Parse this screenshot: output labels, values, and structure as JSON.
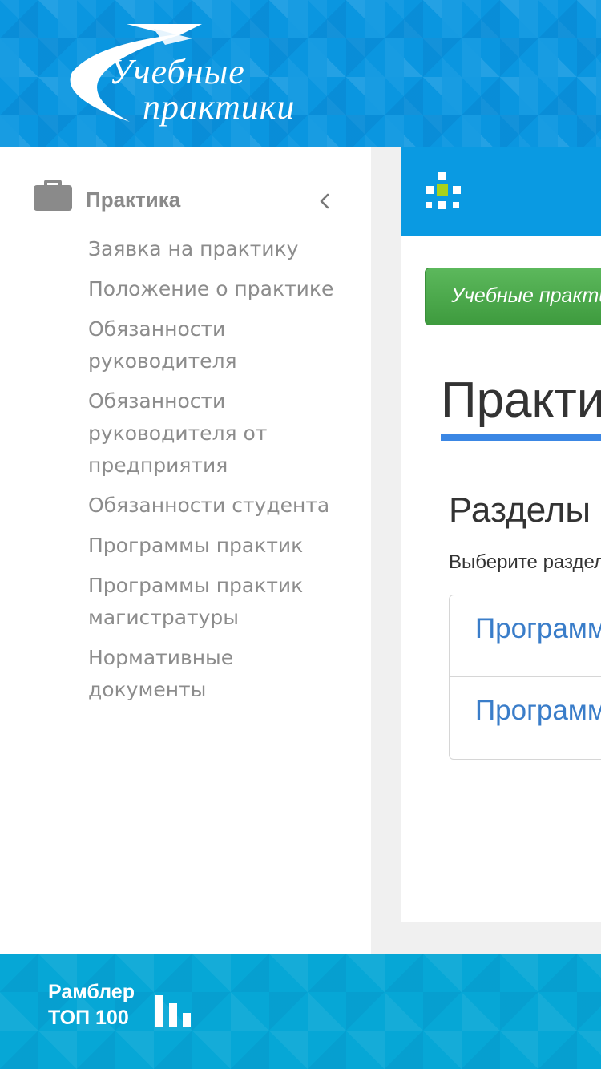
{
  "header": {
    "logo_line1": "Учебные",
    "logo_line2": "практики",
    "logo_icon": "plane-swoosh-icon",
    "background_color": "#0a96e0"
  },
  "sidebar": {
    "section_title": "Практика",
    "section_icon": "briefcase-icon",
    "toggle_icon": "chevron-left-icon",
    "items": [
      {
        "label": "Заявка на практику"
      },
      {
        "label": "Положение о практике"
      },
      {
        "label": "Обязанности руководителя"
      },
      {
        "label": "Обязанности руководителя от предприятия"
      },
      {
        "label": "Обязанности студента"
      },
      {
        "label": "Программы практик"
      },
      {
        "label": "Программы практик магистратуры"
      },
      {
        "label": "Нормативные документы"
      }
    ]
  },
  "main": {
    "topbar_icon": "grid-dots-icon",
    "topbar_color": "#0a9ae2",
    "breadcrumb_button": "Учебные практики",
    "breadcrumb_color": "#4cae4c",
    "page_title": "Практика",
    "title_underline_color": "#3b87e4",
    "sections_heading": "Разделы",
    "sections_hint": "Выберите раздел",
    "sections": [
      {
        "label": "Программы практик"
      },
      {
        "label": "Программы практик магистратуры"
      }
    ],
    "link_color": "#3a7dc9"
  },
  "footer": {
    "counter_line1": "Рамблер",
    "counter_line2": "ТОП 100",
    "counter_icon": "bar-chart-icon",
    "background_color": "#06a7d6"
  }
}
